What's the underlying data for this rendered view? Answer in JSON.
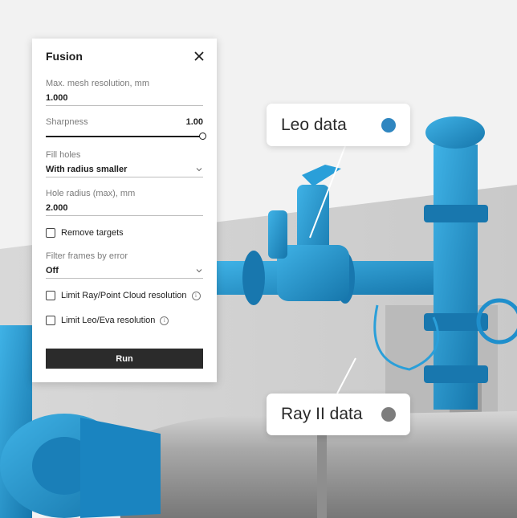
{
  "panel": {
    "title": "Fusion",
    "close_icon": "close-icon",
    "mesh_resolution": {
      "label": "Max. mesh resolution, mm",
      "value": "1.000"
    },
    "sharpness": {
      "label": "Sharpness",
      "value": "1.00",
      "level_fraction": 1.0
    },
    "fill_holes": {
      "label": "Fill holes",
      "value": "With radius smaller",
      "icon": "chevron-down-icon"
    },
    "hole_radius": {
      "label": "Hole radius (max), mm",
      "value": "2.000"
    },
    "remove_targets": {
      "label": "Remove targets",
      "checked": false
    },
    "filter_frames": {
      "label": "Filter frames by error",
      "value": "Off",
      "icon": "chevron-down-icon"
    },
    "limit_ray": {
      "label": "Limit Ray/Point Cloud resolution",
      "checked": false,
      "icon": "info-icon"
    },
    "limit_leo": {
      "label": "Limit Leo/Eva resolution",
      "checked": false,
      "icon": "info-icon"
    },
    "run_label": "Run"
  },
  "callouts": {
    "leo": {
      "label": "Leo data",
      "color": "#2f86c0"
    },
    "ray": {
      "label": "Ray II data",
      "color": "#7d7d7d"
    }
  },
  "colors": {
    "leo_mesh": "#1e9bd7",
    "ray_mesh": "#bdbdbd"
  }
}
